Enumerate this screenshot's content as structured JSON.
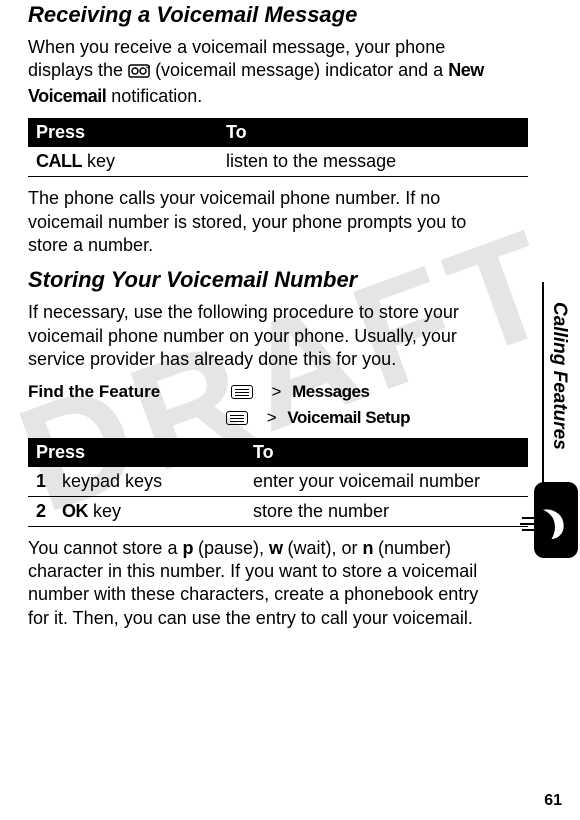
{
  "watermark": "DRAFT",
  "side_label": "Calling Features",
  "page_number": "61",
  "section1": {
    "heading": "Receiving a Voicemail Message",
    "para1_a": "When you receive a voicemail message, your phone displays the ",
    "para1_b": " (voicemail message) indicator and a ",
    "new_vm": "New Voicemail",
    "para1_c": " notification.",
    "table": {
      "h1": "Press",
      "h2": "To",
      "r1c1_bold": "CALL",
      "r1c1_rest": " key",
      "r1c2": "listen to the message"
    },
    "para2": "The phone calls your voicemail phone number. If no voicemail number is stored, your phone prompts you to store a number."
  },
  "section2": {
    "heading": "Storing Your Voicemail Number",
    "para1": "If necessary, use the following procedure to store your voicemail phone number on your phone. Usually, your service provider has already done this for you.",
    "find_feature": "Find the Feature",
    "gt": ">",
    "menu1": "Messages",
    "menu2": "Voicemail Setup",
    "table": {
      "h1": "Press",
      "h2": "To",
      "r1num": "1",
      "r1c1": "keypad keys",
      "r1c2": "enter your voicemail number",
      "r2num": "2",
      "r2c1_bold": "OK",
      "r2c1_rest": " key",
      "r2c2": "store the number"
    },
    "para2_a": "You cannot store a ",
    "p": "p",
    "para2_b": " (pause), ",
    "w": "w",
    "para2_c": " (wait), or ",
    "n": "n",
    "para2_d": " (number) character in this number. If you want to store a voicemail number with these characters, create a phonebook entry for it. Then, you can use the entry to call your voicemail."
  }
}
